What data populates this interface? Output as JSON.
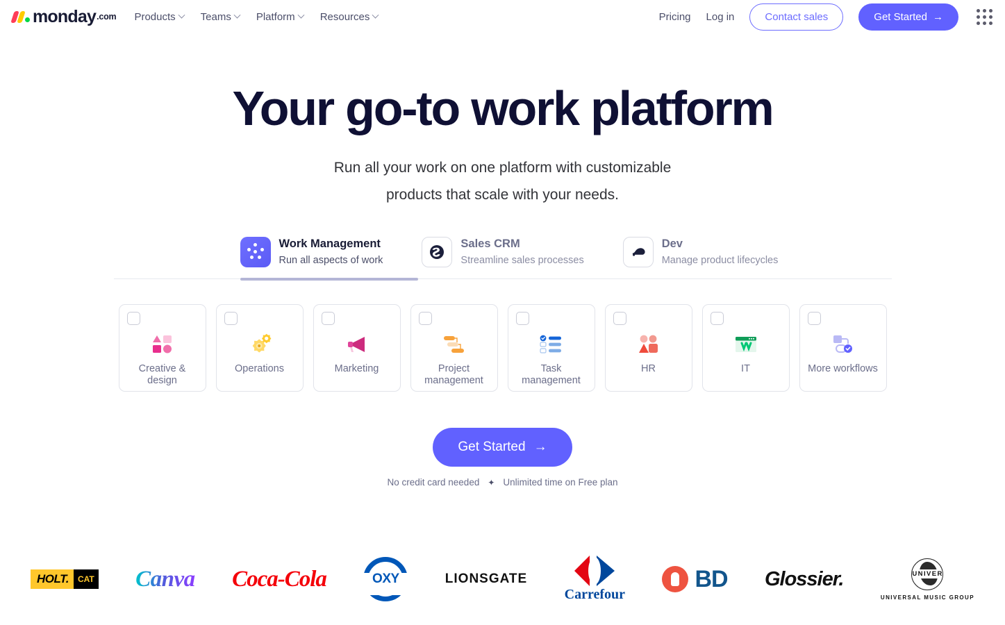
{
  "brand": {
    "name": "monday",
    "suffix": ".com",
    "colors": {
      "primary": "#6161ff",
      "accent_pink": "#ff3d57",
      "accent_yellow": "#ffcb00",
      "accent_green": "#00d647"
    }
  },
  "header": {
    "nav": [
      {
        "label": "Products",
        "has_chevron": true
      },
      {
        "label": "Teams",
        "has_chevron": true
      },
      {
        "label": "Platform",
        "has_chevron": true
      },
      {
        "label": "Resources",
        "has_chevron": true
      }
    ],
    "pricing_label": "Pricing",
    "login_label": "Log in",
    "contact_sales_label": "Contact sales",
    "get_started_label": "Get Started",
    "get_started_arrow": "→",
    "apps_icon": "apps-grid-icon"
  },
  "hero": {
    "title": "Your go-to work platform",
    "subtitle_line1": "Run all your work on one platform with customizable",
    "subtitle_line2": "products that scale with your needs."
  },
  "product_tabs": [
    {
      "title": "Work Management",
      "desc": "Run all aspects of work",
      "icon": "work-management-icon",
      "active": true
    },
    {
      "title": "Sales CRM",
      "desc": "Streamline sales processes",
      "icon": "sales-crm-icon",
      "active": false
    },
    {
      "title": "Dev",
      "desc": "Manage product lifecycles",
      "icon": "dev-icon",
      "active": false
    }
  ],
  "workflow_cards": [
    {
      "label": "Creative & design",
      "icon": "creative-design-icon"
    },
    {
      "label": "Operations",
      "icon": "operations-icon"
    },
    {
      "label": "Marketing",
      "icon": "marketing-icon"
    },
    {
      "label": "Project management",
      "icon": "project-management-icon"
    },
    {
      "label": "Task management",
      "icon": "task-management-icon"
    },
    {
      "label": "HR",
      "icon": "hr-icon"
    },
    {
      "label": "IT",
      "icon": "it-icon"
    },
    {
      "label": "More workflows",
      "icon": "more-workflows-icon"
    }
  ],
  "cta": {
    "button_label": "Get Started",
    "button_arrow": "→",
    "note_left": "No credit card needed",
    "note_sep": "✦",
    "note_right": "Unlimited time on Free plan"
  },
  "logos": [
    {
      "name": "HOLT CAT",
      "part1": "HOLT.",
      "part2": "CAT"
    },
    {
      "name": "Canva",
      "text": "Canva"
    },
    {
      "name": "Coca-Cola",
      "text": "Coca-Cola"
    },
    {
      "name": "OXY",
      "text": "OXY"
    },
    {
      "name": "LIONSGATE",
      "text": "LIONSGATE"
    },
    {
      "name": "Carrefour",
      "text": "Carrefour"
    },
    {
      "name": "BD",
      "text": "BD"
    },
    {
      "name": "Glossier",
      "text": "Glossier."
    },
    {
      "name": "Universal Music Group",
      "text": "UNIVERSAL",
      "sub": "UNIVERSAL MUSIC GROUP"
    }
  ]
}
